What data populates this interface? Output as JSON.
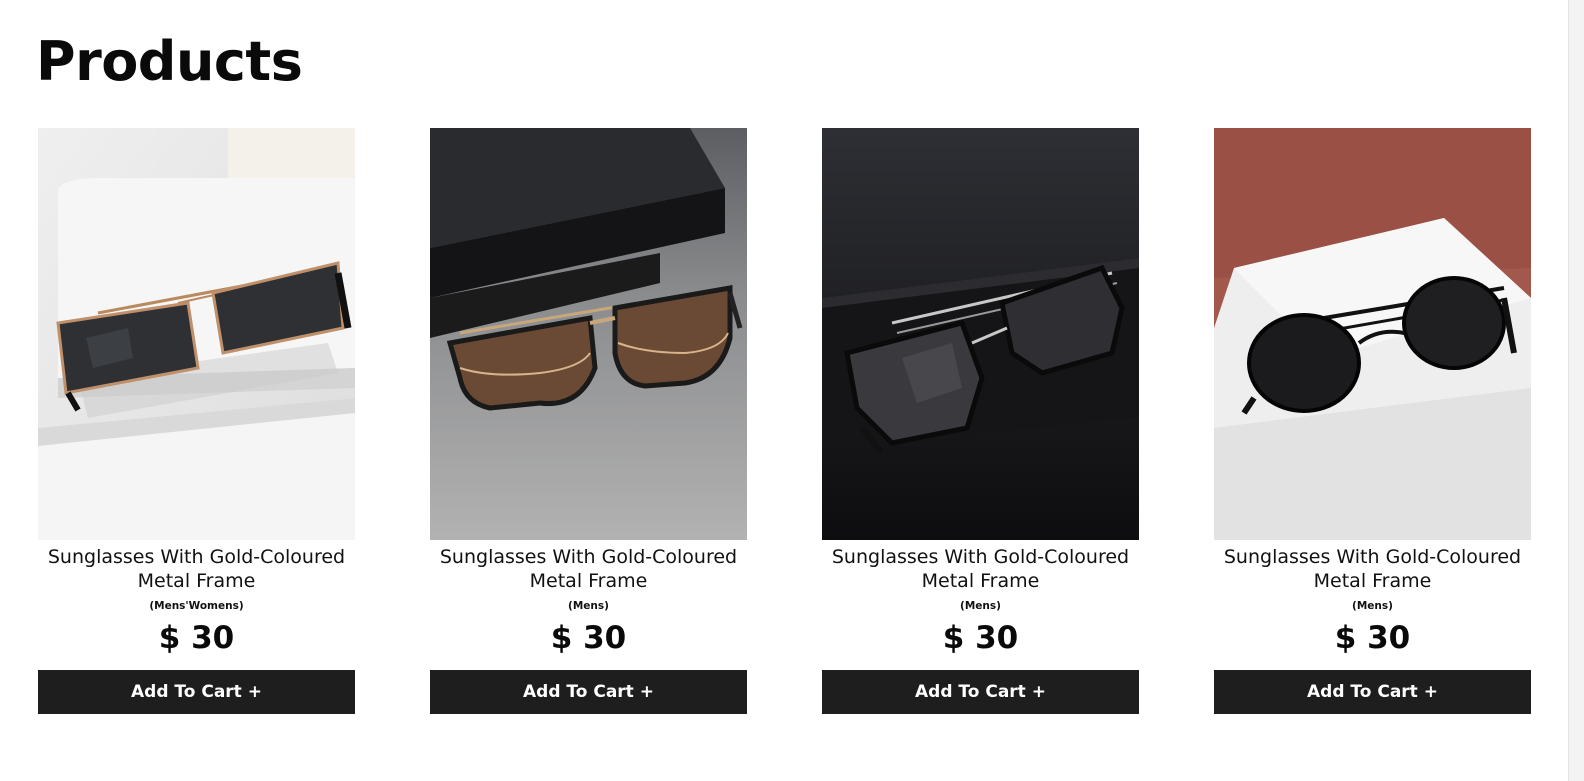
{
  "page": {
    "title": "Products"
  },
  "products": [
    {
      "name": "Sunglasses With Gold-Coloured Metal Frame",
      "category": "(Mens'Womens)",
      "price": "$ 30",
      "button_label": "Add To Cart +",
      "image": "gold-rectangular-sunglasses-on-white-steps"
    },
    {
      "name": "Sunglasses With Gold-Coloured Metal Frame",
      "category": "(Mens)",
      "price": "$ 30",
      "button_label": "Add To Cart +",
      "image": "brown-lens-browline-sunglasses-on-grey-surface"
    },
    {
      "name": "Sunglasses With Gold-Coloured Metal Frame",
      "category": "(Mens)",
      "price": "$ 30",
      "button_label": "Add To Cart +",
      "image": "black-hexagonal-sunglasses-on-dark-leather"
    },
    {
      "name": "Sunglasses With Gold-Coloured Metal Frame",
      "category": "(Mens)",
      "price": "$ 30",
      "button_label": "Add To Cart +",
      "image": "black-round-aviator-sunglasses-on-white-block"
    }
  ],
  "colors": {
    "button_background": "#1e1e1e",
    "button_text": "#ffffff",
    "text": "#111111",
    "page_background": "#ffffff"
  }
}
